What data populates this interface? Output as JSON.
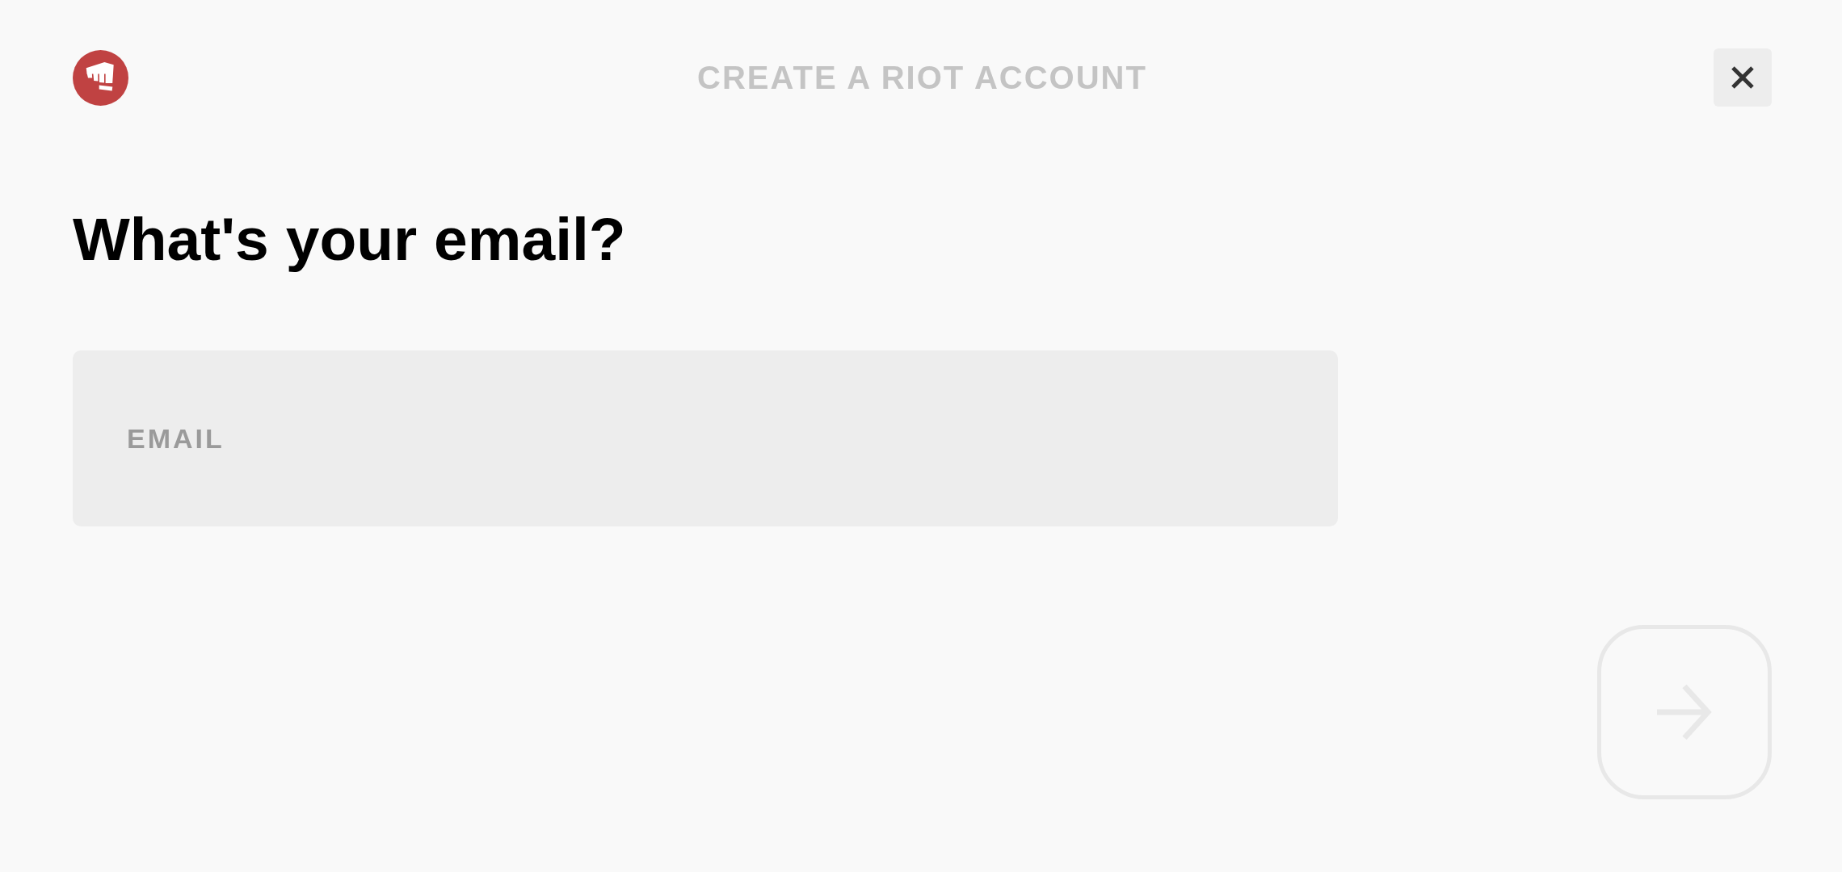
{
  "header": {
    "title": "CREATE A RIOT ACCOUNT"
  },
  "heading": "What's your email?",
  "email_field": {
    "placeholder": "EMAIL"
  },
  "next_button": {
    "disabled": true
  }
}
